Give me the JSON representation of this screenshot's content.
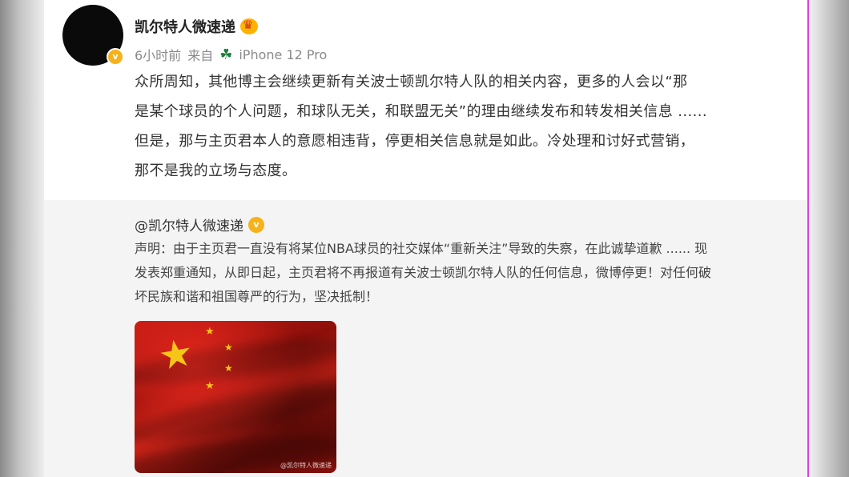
{
  "post": {
    "username": "凯尔特人微速递",
    "time": "6小时前",
    "source_prefix": "来自",
    "device": "iPhone 12 Pro",
    "text_lines": [
      "众所周知，其他博主会继续更新有关波士顿凯尔特人队的相关内容，更多的人会以“那",
      "是某个球员的个人问题，和球队无关，和联盟无关”的理由继续发布和转发相关信息 ......",
      "但是，那与主页君本人的意愿相违背，停更相关信息就是如此。冷处理和讨好式营销，",
      "那不是我的立场与态度。"
    ]
  },
  "repost": {
    "username": "@凯尔特人微速递",
    "text_lines": [
      "声明：由于主页君一直没有将某位NBA球员的社交媒体“重新关注”导致的失察，在此诚挚道歉 ...... 现",
      "发表郑重通知，从即日起，主页君将不再报道有关波士顿凯尔特人队的任何信息，微博停更！对任何破",
      "坏民族和谐和祖国尊严的行为，坚决抵制！"
    ],
    "image_watermark": "@凯尔特人微速递"
  },
  "icons": {
    "avatar_badge": "verified-icon",
    "crown": "crown-icon",
    "device": "clover-icon"
  },
  "colors": {
    "verified": "#f6b21b",
    "repost_bg": "#f4f4f4",
    "flag_red": "#c41a12",
    "star_yellow": "#f5c518"
  }
}
